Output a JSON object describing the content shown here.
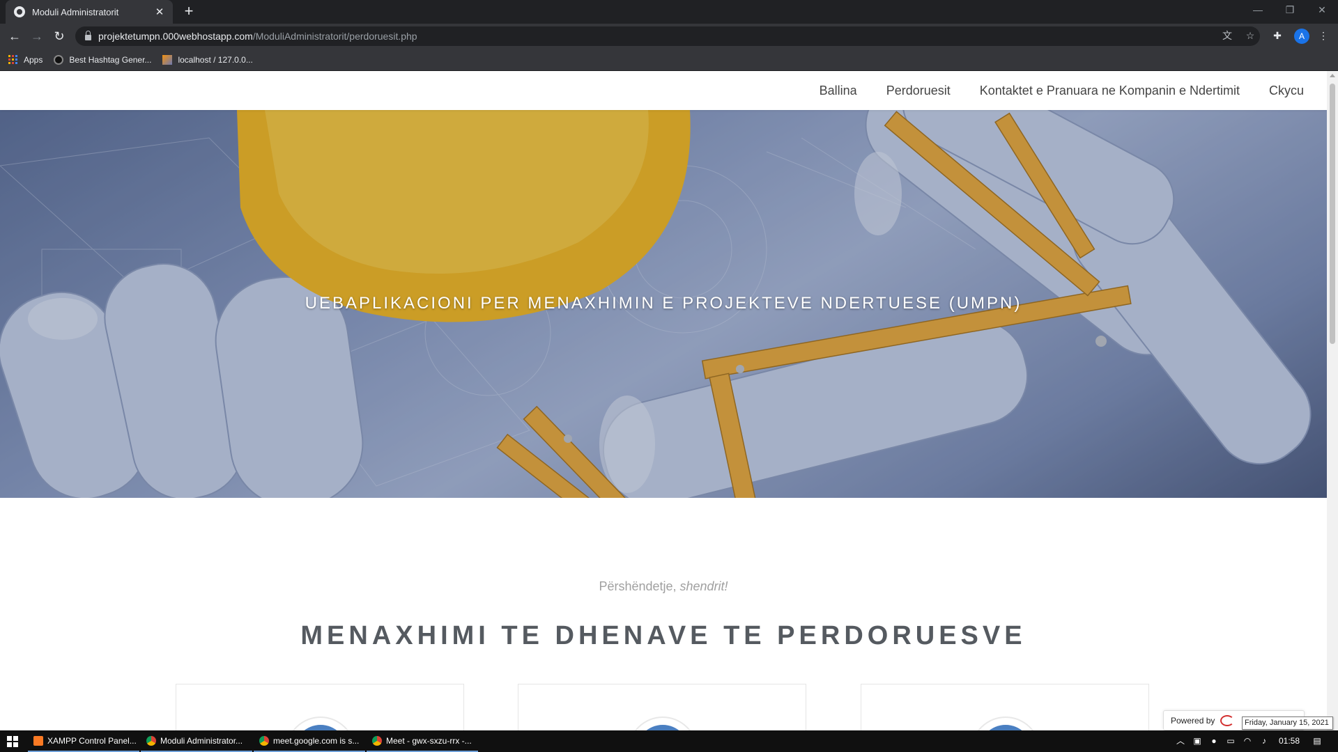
{
  "browser": {
    "tab_title": "Moduli Administratorit",
    "url_host": "projektetumpn.000webhostapp.com",
    "url_path": "/ModuliAdministratorit/perdoruesit.php",
    "profile_initial": "A",
    "bookmarks": [
      {
        "label": "Apps"
      },
      {
        "label": "Best Hashtag Gener..."
      },
      {
        "label": "localhost / 127.0.0..."
      }
    ]
  },
  "site_nav": {
    "items": [
      {
        "label": "Ballina"
      },
      {
        "label": "Perdoruesit"
      },
      {
        "label": "Kontaktet e Pranuara ne Kompanin e Ndertimit"
      },
      {
        "label": "Ckycu"
      }
    ]
  },
  "hero": {
    "title": "UEBAPLIKACIONI PER MENAXHIMIN E PROJEKTEVE NDERTUESE (UMPN)"
  },
  "main": {
    "greeting_prefix": "Përshëndetje, ",
    "greeting_user": "shendrit!",
    "section_title": "MENAXHIMI TE DHENAVE TE PERDORUESVE"
  },
  "widget": {
    "powered_by": "Powered by",
    "tooltip": "Friday, January 15, 2021"
  },
  "taskbar": {
    "tasks": [
      {
        "label": "XAMPP Control Panel...",
        "icon_color": "#fb7a24"
      },
      {
        "label": "Moduli Administrator...",
        "icon_color": "#4285f4"
      },
      {
        "label": "meet.google.com is s...",
        "icon_color": "#4285f4"
      },
      {
        "label": "Meet - gwx-sxzu-rrx -...",
        "icon_color": "#4285f4"
      }
    ],
    "clock": "01:58"
  },
  "colors": {
    "chrome_dark": "#202124",
    "chrome_toolbar": "#35363a",
    "accent_blue": "#4a7fc1",
    "heading_grey": "#555a60"
  }
}
